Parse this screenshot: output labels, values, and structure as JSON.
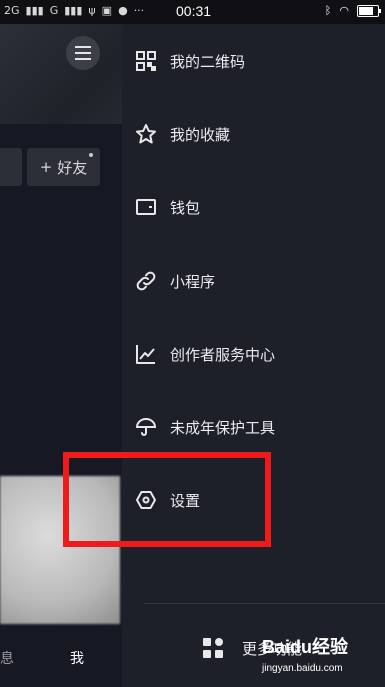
{
  "status_bar": {
    "signal_left": "2G",
    "signal_right": "G",
    "time": "00:31"
  },
  "profile": {
    "add_friend_label": "好友",
    "nav_messages": "息",
    "nav_me": "我"
  },
  "drawer": {
    "items": [
      {
        "label": "我的二维码",
        "icon": "qr-code-icon"
      },
      {
        "label": "我的收藏",
        "icon": "star-icon"
      },
      {
        "label": "钱包",
        "icon": "wallet-icon"
      },
      {
        "label": "小程序",
        "icon": "link-icon"
      },
      {
        "label": "创作者服务中心",
        "icon": "chart-icon"
      },
      {
        "label": "未成年保护工具",
        "icon": "umbrella-icon"
      },
      {
        "label": "设置",
        "icon": "settings-icon"
      }
    ],
    "more_label": "更多功能"
  },
  "watermark": {
    "brand": "Baidu经验",
    "url": "jingyan.baidu.com"
  },
  "colors": {
    "background": "#161823",
    "drawer": "#1e2029",
    "highlight": "#f01a1a",
    "text": "#ececef"
  }
}
